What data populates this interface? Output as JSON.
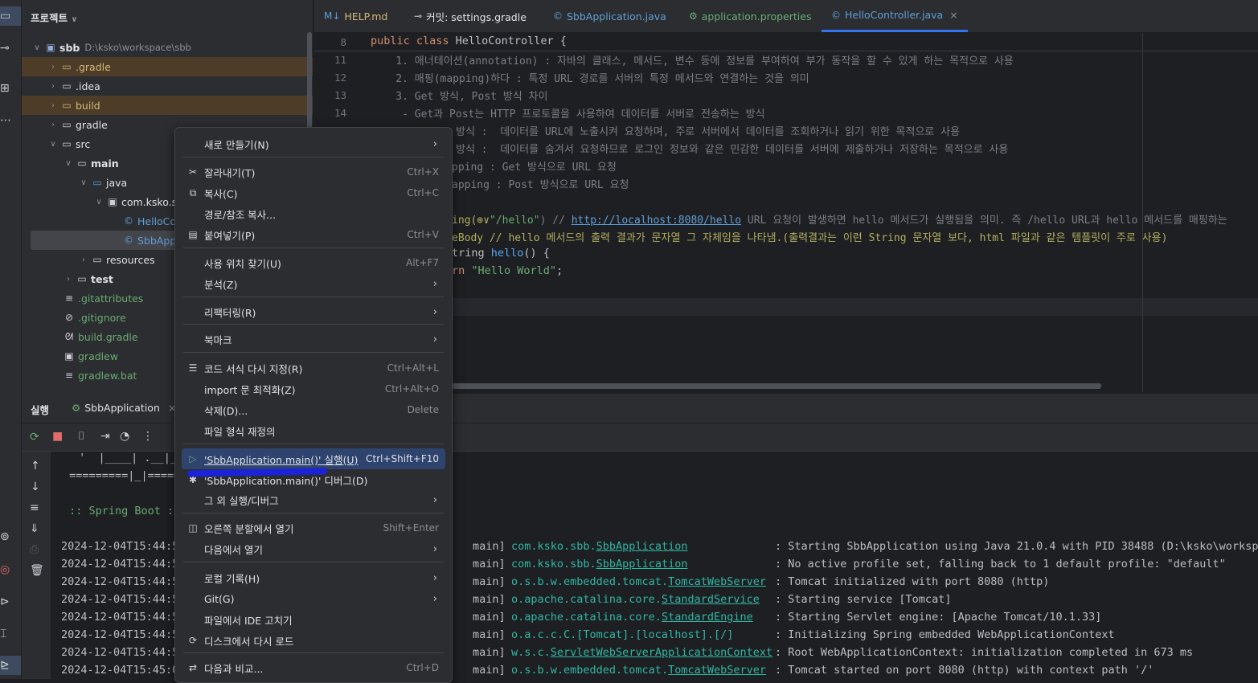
{
  "project": {
    "title": "프로젝트",
    "tree": [
      {
        "name": "sbb",
        "path": "D:\\ksko\\workspace\\sbb"
      },
      {
        "name": ".gradle"
      },
      {
        "name": ".idea"
      },
      {
        "name": "build"
      },
      {
        "name": "gradle"
      },
      {
        "name": "src"
      },
      {
        "name": "main"
      },
      {
        "name": "java"
      },
      {
        "name": "com.ksko.sb"
      },
      {
        "name": "HelloCo"
      },
      {
        "name": "SbbApp"
      },
      {
        "name": "resources"
      },
      {
        "name": "test"
      },
      {
        "name": ".gitattributes"
      },
      {
        "name": ".gitignore"
      },
      {
        "name": "build.gradle"
      },
      {
        "name": "gradlew"
      },
      {
        "name": "gradlew.bat"
      }
    ]
  },
  "tabs": [
    {
      "label": "HELP.md",
      "icon": "markdown-icon"
    },
    {
      "label": "커밋: settings.gradle",
      "icon": "commit-icon"
    },
    {
      "label": "SbbApplication.java",
      "icon": "java-class-icon"
    },
    {
      "label": "application.properties",
      "icon": "properties-icon"
    },
    {
      "label": "HelloController.java",
      "icon": "java-class-icon"
    }
  ],
  "editor": {
    "line_numbers": [
      "8",
      "11",
      "12",
      "13",
      "14"
    ],
    "lines": {
      "l8_kw": "public class ",
      "l8_name": "HelloController {",
      "l11": "    1. 애너테이션(annotation) : 자바의 클래스, 메서드, 변수 등에 정보를 부여하여 부가 동작을 할 수 있게 하는 목적으로 사용",
      "l12": "    2. 매핑(mapping)하다 : 특정 URL 경로를 서버의 특정 메서드와 연결하는 것을 의미",
      "l13": "    3. Get 방식, Post 방식 차이",
      "l14": "     - Get과 Post는 HTTP 프로토콜을 사용하여 데이터를 서버로 전송하는 방식",
      "l15": "방식 :  데이터를 URL에 노출시켜 요청하며, 주로 서버에서 데이터를 조회하거나 읽기 위한 목적으로 사용",
      "l16": "방식 :  데이터를 숨겨서 요청하므로 로그인 정보와 같은 민감한 데이터를 서버에 제출하거나 저장하는 목적으로 사용",
      "l17": "pping : Get 방식으로 URL 요청",
      "l18": "apping : Post 방식으로 URL 요청",
      "l20_a": "ing(⊕∨",
      "l20_str": "\"/hello\"",
      "l20_b": ") // ",
      "l20_url": "http://localhost:8080/hello",
      "l20_c": " URL 요청이 발생하면 hello 메서드가 실행됨을 의미. 즉 /hello URL과 hello 메서드를 매핑하는",
      "l21": "eBody // hello 메서드의 출력 결과가 문자열 그 자체임을 나타냄.(출력결과는 이런 String 문자열 보다, html 파일과 같은 템플릿이 주로 사용)",
      "l22_a": "tring ",
      "l22_fn": "hello",
      "l22_b": "() {",
      "l23_kw": "rn ",
      "l23_str": "\"Hello World\"",
      "l23_b": ";"
    }
  },
  "run": {
    "title": "실행",
    "tab": "SbbApplication",
    "banner1": " '  |____| .__|_",
    "banner2": " =========|_|=====",
    "banner3": " :: Spring Boot ::",
    "timestamps": [
      "2024-12-04T15:44:5",
      "2024-12-04T15:44:5",
      "2024-12-04T15:44:5",
      "2024-12-04T15:44:5",
      "2024-12-04T15:44:5",
      "2024-12-04T15:44:5",
      "2024-12-04T15:44:5",
      "2024-12-04T15:45:0"
    ],
    "threads": [
      "main]",
      "main]",
      "main]",
      "main]",
      "main]",
      "main]",
      "main]",
      "main]"
    ],
    "logger_prefix": [
      "com.ksko.sbb.",
      "com.ksko.sbb.",
      "o.s.b.w.embedded.tomcat.",
      "o.apache.catalina.core.",
      "o.apache.catalina.core.",
      "o.a.c.c.C.[Tomcat].[localhost].[/]",
      "w.s.c.",
      "o.s.b.w.embedded.tomcat."
    ],
    "logger_class": [
      "SbbApplication",
      "SbbApplication",
      "TomcatWebServer",
      "StandardService",
      "StandardEngine",
      "",
      "ServletWebServerApplicationContext",
      "TomcatWebServer"
    ],
    "messages": [
      ": Starting SbbApplication using Java 21.0.4 with PID 38488 (D:\\ksko\\workspa",
      ": No active profile set, falling back to 1 default profile: \"default\"",
      ": Tomcat initialized with port 8080 (http)",
      ": Starting service [Tomcat]",
      ": Starting Servlet engine: [Apache Tomcat/10.1.33]",
      ": Initializing Spring embedded WebApplicationContext",
      ": Root WebApplicationContext: initialization completed in 673 ms",
      ": Tomcat started on port 8080 (http) with context path '/'"
    ]
  },
  "menu": {
    "items": [
      {
        "label": "새로 만들기(N)",
        "shortcut": "",
        "submenu": true,
        "icon": ""
      },
      {
        "label": "잘라내기(T)",
        "shortcut": "Ctrl+X",
        "icon": "✂"
      },
      {
        "label": "복사(C)",
        "shortcut": "Ctrl+C",
        "icon": "⧉"
      },
      {
        "label": "경로/참조 복사...",
        "shortcut": "",
        "icon": ""
      },
      {
        "label": "붙여넣기(P)",
        "shortcut": "Ctrl+V",
        "icon": "▤"
      },
      {
        "label": "사용 위치 찾기(U)",
        "shortcut": "Alt+F7",
        "icon": ""
      },
      {
        "label": "분석(Z)",
        "shortcut": "",
        "submenu": true,
        "icon": ""
      },
      {
        "label": "리팩터링(R)",
        "shortcut": "",
        "submenu": true,
        "icon": ""
      },
      {
        "label": "북마크",
        "shortcut": "",
        "submenu": true,
        "icon": ""
      },
      {
        "label": "코드 서식 다시 지정(R)",
        "shortcut": "Ctrl+Alt+L",
        "icon": "☰"
      },
      {
        "label": "import 문 최적화(Z)",
        "shortcut": "Ctrl+Alt+O",
        "icon": ""
      },
      {
        "label": "삭제(D)...",
        "shortcut": "Delete",
        "icon": ""
      },
      {
        "label": "파일 형식 재정의",
        "shortcut": "",
        "icon": ""
      },
      {
        "label": "'SbbApplication.main()' 실행(U)",
        "shortcut": "Ctrl+Shift+F10",
        "icon": "▷"
      },
      {
        "label": "'SbbApplication.main()' 디버그(D)",
        "shortcut": "",
        "icon": "✱"
      },
      {
        "label": "그 외 실행/디버그",
        "shortcut": "",
        "submenu": true,
        "icon": ""
      },
      {
        "label": "오른쪽 분할에서 열기",
        "shortcut": "Shift+Enter",
        "icon": "◫"
      },
      {
        "label": "다음에서 열기",
        "shortcut": "",
        "submenu": true,
        "icon": ""
      },
      {
        "label": "로컬 기록(H)",
        "shortcut": "",
        "submenu": true,
        "icon": ""
      },
      {
        "label": "Git(G)",
        "shortcut": "",
        "submenu": true,
        "icon": ""
      },
      {
        "label": "파일에서 IDE 고치기",
        "shortcut": "",
        "icon": ""
      },
      {
        "label": "디스크에서 다시 로드",
        "shortcut": "",
        "icon": "⟳"
      },
      {
        "label": "다음과 비교...",
        "shortcut": "Ctrl+D",
        "icon": "⇄"
      }
    ]
  },
  "colors": {
    "accent": "#3574f0",
    "menu_highlight": "#2e436e",
    "logger": "#2fb7a5",
    "folder_highlight": "#4d3d28"
  }
}
